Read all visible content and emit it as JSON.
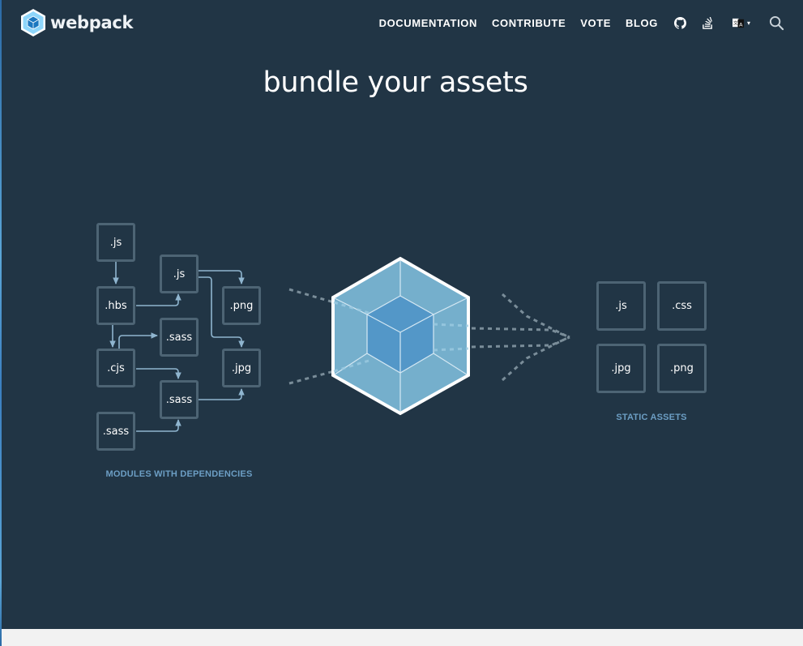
{
  "brand": {
    "name": "webpack",
    "logo_icon": "webpack-cube-logo"
  },
  "nav": {
    "links": [
      {
        "label": "DOCUMENTATION"
      },
      {
        "label": "CONTRIBUTE"
      },
      {
        "label": "VOTE"
      },
      {
        "label": "BLOG"
      }
    ],
    "icons": [
      "github-icon",
      "stack-overflow-icon",
      "language-icon",
      "search-icon"
    ],
    "language_caret": "▾"
  },
  "hero": {
    "title": "bundle your assets",
    "modules": {
      "caption": "MODULES WITH DEPENDENCIES",
      "boxes": [
        ".js",
        ".js",
        ".hbs",
        ".png",
        ".sass",
        ".cjs",
        ".jpg",
        ".sass",
        ".sass"
      ]
    },
    "static_assets": {
      "caption": "STATIC ASSETS",
      "boxes": [
        ".js",
        ".css",
        ".jpg",
        ".png"
      ]
    }
  },
  "colors": {
    "background": "#213545",
    "box_border": "#4d6474",
    "arrow": "#8fb5cf",
    "caption": "#6c9ec4",
    "cube_outer": "#75afcc",
    "cube_inner": "#5397c8",
    "page_bottom": "#f2f2f2"
  }
}
